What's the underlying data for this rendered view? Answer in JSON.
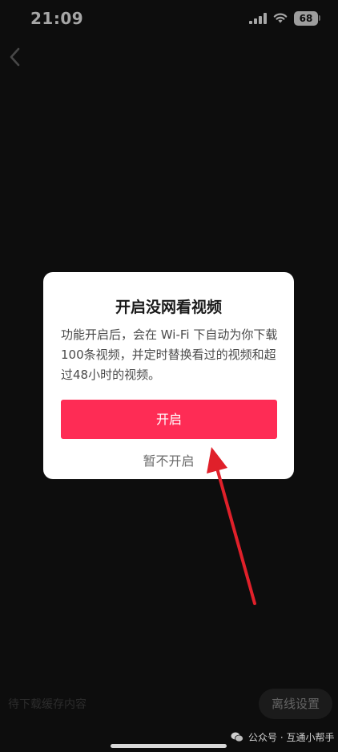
{
  "status_bar": {
    "time": "21:09",
    "battery": "68",
    "icons": [
      "signal-icon",
      "wifi-icon",
      "battery-icon"
    ]
  },
  "nav": {
    "back_icon": "back-icon"
  },
  "dialog": {
    "title": "开启没网看视频",
    "body": "功能开启后，会在 Wi-Fi 下自动为你下载100条视频，并定时替换看过的视频和超过48小时的视频。",
    "primary_label": "开启",
    "secondary_label": "暂不开启"
  },
  "bottom": {
    "pending_label": "待下载缓存内容",
    "offline_settings_label": "离线设置"
  },
  "watermark": {
    "text": "公众号 · 互通小帮手",
    "icon": "wechat-icon"
  },
  "colors": {
    "accent": "#fe2c55",
    "annotation_arrow": "#e0202a",
    "background": "#141414"
  }
}
